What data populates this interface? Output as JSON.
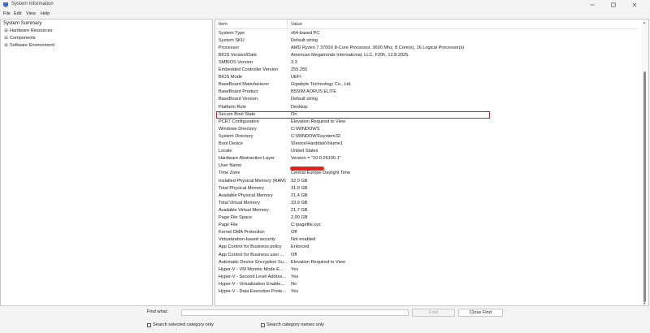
{
  "window": {
    "title": "System Information",
    "icon": "system-info-icon"
  },
  "menubar": {
    "items": [
      "File",
      "Edit",
      "View",
      "Help"
    ]
  },
  "tree": {
    "root": "System Summary",
    "children": [
      {
        "label": "Hardware Resources",
        "expander": "⊞"
      },
      {
        "label": "Components",
        "expander": "⊞"
      },
      {
        "label": "Software Environment",
        "expander": "⊞"
      }
    ]
  },
  "table": {
    "headers": {
      "item": "Item",
      "value": "Value"
    },
    "rows": [
      {
        "item": "System Type",
        "value": "x64-based PC"
      },
      {
        "item": "System SKU",
        "value": "Default string"
      },
      {
        "item": "Processor",
        "value": "AMD Ryzen 7 3700X 8-Core Processor, 3600 Mhz, 8 Core(s), 16 Logical Processor(s)"
      },
      {
        "item": "BIOS Version/Date",
        "value": "American Megatrends International, LLC. F20h, 12.8.2025."
      },
      {
        "item": "SMBIOS Version",
        "value": "3.3"
      },
      {
        "item": "Embedded Controller Version",
        "value": "255.255"
      },
      {
        "item": "BIOS Mode",
        "value": "UEFI"
      },
      {
        "item": "BaseBoard Manufacturer",
        "value": "Gigabyte Technology Co., Ltd."
      },
      {
        "item": "BaseBoard Product",
        "value": "B550M AORUS ELITE"
      },
      {
        "item": "BaseBoard Version",
        "value": "Default string"
      },
      {
        "item": "Platform Role",
        "value": "Desktop"
      },
      {
        "item": "Secure Boot State",
        "value": "On"
      },
      {
        "item": "PCR7 Configuration",
        "value": "Elevation Required to View"
      },
      {
        "item": "Windows Directory",
        "value": "C:\\WINDOWS"
      },
      {
        "item": "System Directory",
        "value": "C:\\WINDOWS\\system32"
      },
      {
        "item": "Boot Device",
        "value": "\\Device\\HarddiskVolume1"
      },
      {
        "item": "Locale",
        "value": "United States"
      },
      {
        "item": "Hardware Abstraction Layer",
        "value": "Version = \"10.0.26100.1\""
      },
      {
        "item": "User Name",
        "value": ""
      },
      {
        "item": "Time Zone",
        "value": "Central Europe Daylight Time"
      },
      {
        "item": "Installed Physical Memory (RAM)",
        "value": "32,0 GB"
      },
      {
        "item": "Total Physical Memory",
        "value": "31,9 GB"
      },
      {
        "item": "Available Physical Memory",
        "value": "21,4 GB"
      },
      {
        "item": "Total Virtual Memory",
        "value": "33,9 GB"
      },
      {
        "item": "Available Virtual Memory",
        "value": "21,7 GB"
      },
      {
        "item": "Page File Space",
        "value": "2,00 GB"
      },
      {
        "item": "Page File",
        "value": "C:\\pagefile.sys"
      },
      {
        "item": "Kernel DMA Protection",
        "value": "Off"
      },
      {
        "item": "Virtualization-based security",
        "value": "Not enabled"
      },
      {
        "item": "App Control for Business policy",
        "value": "Enforced"
      },
      {
        "item": "App Control for Business user ...",
        "value": "Off"
      },
      {
        "item": "Automatic Device Encryption Su...",
        "value": "Elevation Required to View"
      },
      {
        "item": "Hyper-V - VM Monitor Mode E...",
        "value": "Yes"
      },
      {
        "item": "Hyper-V - Second Level Addres...",
        "value": "Yes"
      },
      {
        "item": "Hyper-V - Virtualization Enable...",
        "value": "No"
      },
      {
        "item": "Hyper-V - Data Execution Prote...",
        "value": "Yes"
      }
    ]
  },
  "find": {
    "label": "Find what:",
    "value": "",
    "find_button": "Find",
    "close_button": "Close Find",
    "search_selected": "Search selected category only",
    "search_names": "Search category names only"
  },
  "colors": {
    "highlight": "#d32020",
    "redaction": "#e2231a"
  }
}
